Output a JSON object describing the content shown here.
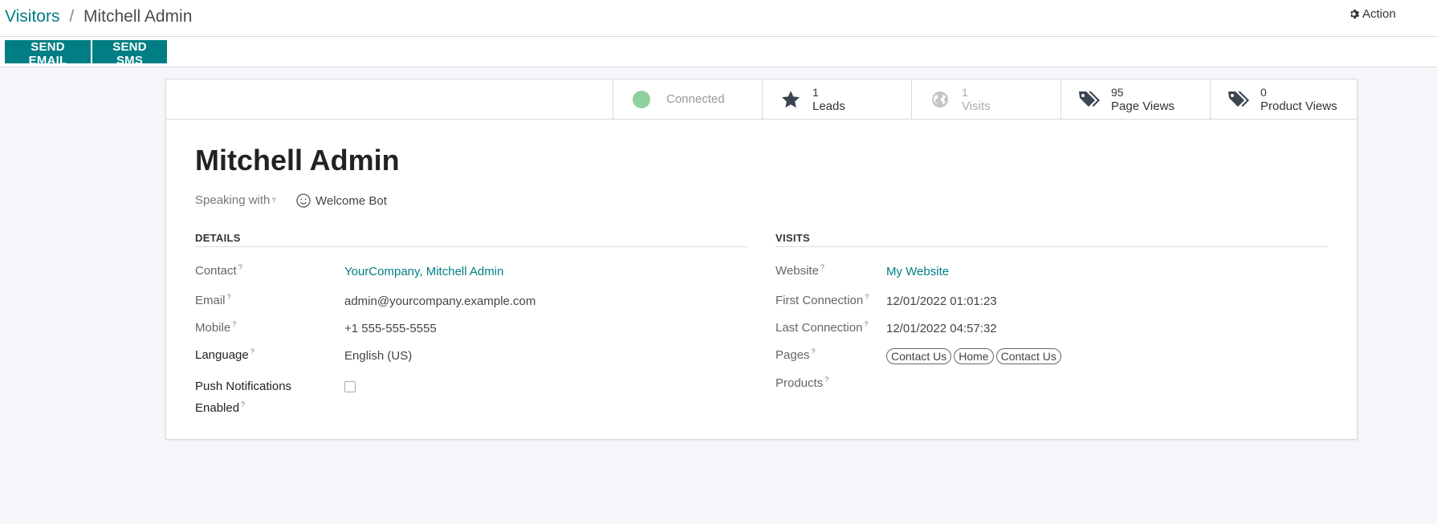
{
  "breadcrumb": {
    "parent": "Visitors",
    "separator": "/",
    "current": "Mitchell Admin"
  },
  "action": {
    "label": "Action",
    "icon": "gear-icon"
  },
  "buttons": {
    "send_email": "SEND EMAIL",
    "send_sms": "SEND SMS"
  },
  "stats": {
    "connected": {
      "label": "Connected",
      "color": "#8fd19e"
    },
    "leads": {
      "count": "1",
      "label": "Leads",
      "icon": "star-icon"
    },
    "visits": {
      "count": "1",
      "label": "Visits",
      "icon": "globe-icon"
    },
    "page_views": {
      "count": "95",
      "label": "Page Views",
      "icon": "tags-icon"
    },
    "product_views": {
      "count": "0",
      "label": "Product Views",
      "icon": "tags-icon"
    }
  },
  "record": {
    "name": "Mitchell Admin",
    "speaking_with_label": "Speaking with",
    "speaking_with_value": "Welcome Bot",
    "help_mark": "?"
  },
  "details": {
    "title": "DETAILS",
    "contact_label": "Contact",
    "contact_value": "YourCompany, Mitchell Admin",
    "email_label": "Email",
    "email_value": "admin@yourcompany.example.com",
    "mobile_label": "Mobile",
    "mobile_value": "+1 555-555-5555",
    "language_label": "Language",
    "language_value": "English (US)",
    "push_label_1": "Push Notifications",
    "push_label_2": "Enabled",
    "push_checked": false
  },
  "visits": {
    "title": "VISITS",
    "website_label": "Website",
    "website_value": "My Website",
    "first_label": "First Connection",
    "first_value": "12/01/2022 01:01:23",
    "last_label": "Last Connection",
    "last_value": "12/01/2022 04:57:32",
    "pages_label": "Pages",
    "pages": [
      "Contact Us",
      "Home",
      "Contact Us"
    ],
    "products_label": "Products"
  },
  "colors": {
    "accent": "#017e84",
    "background": "#f5f6f9"
  }
}
